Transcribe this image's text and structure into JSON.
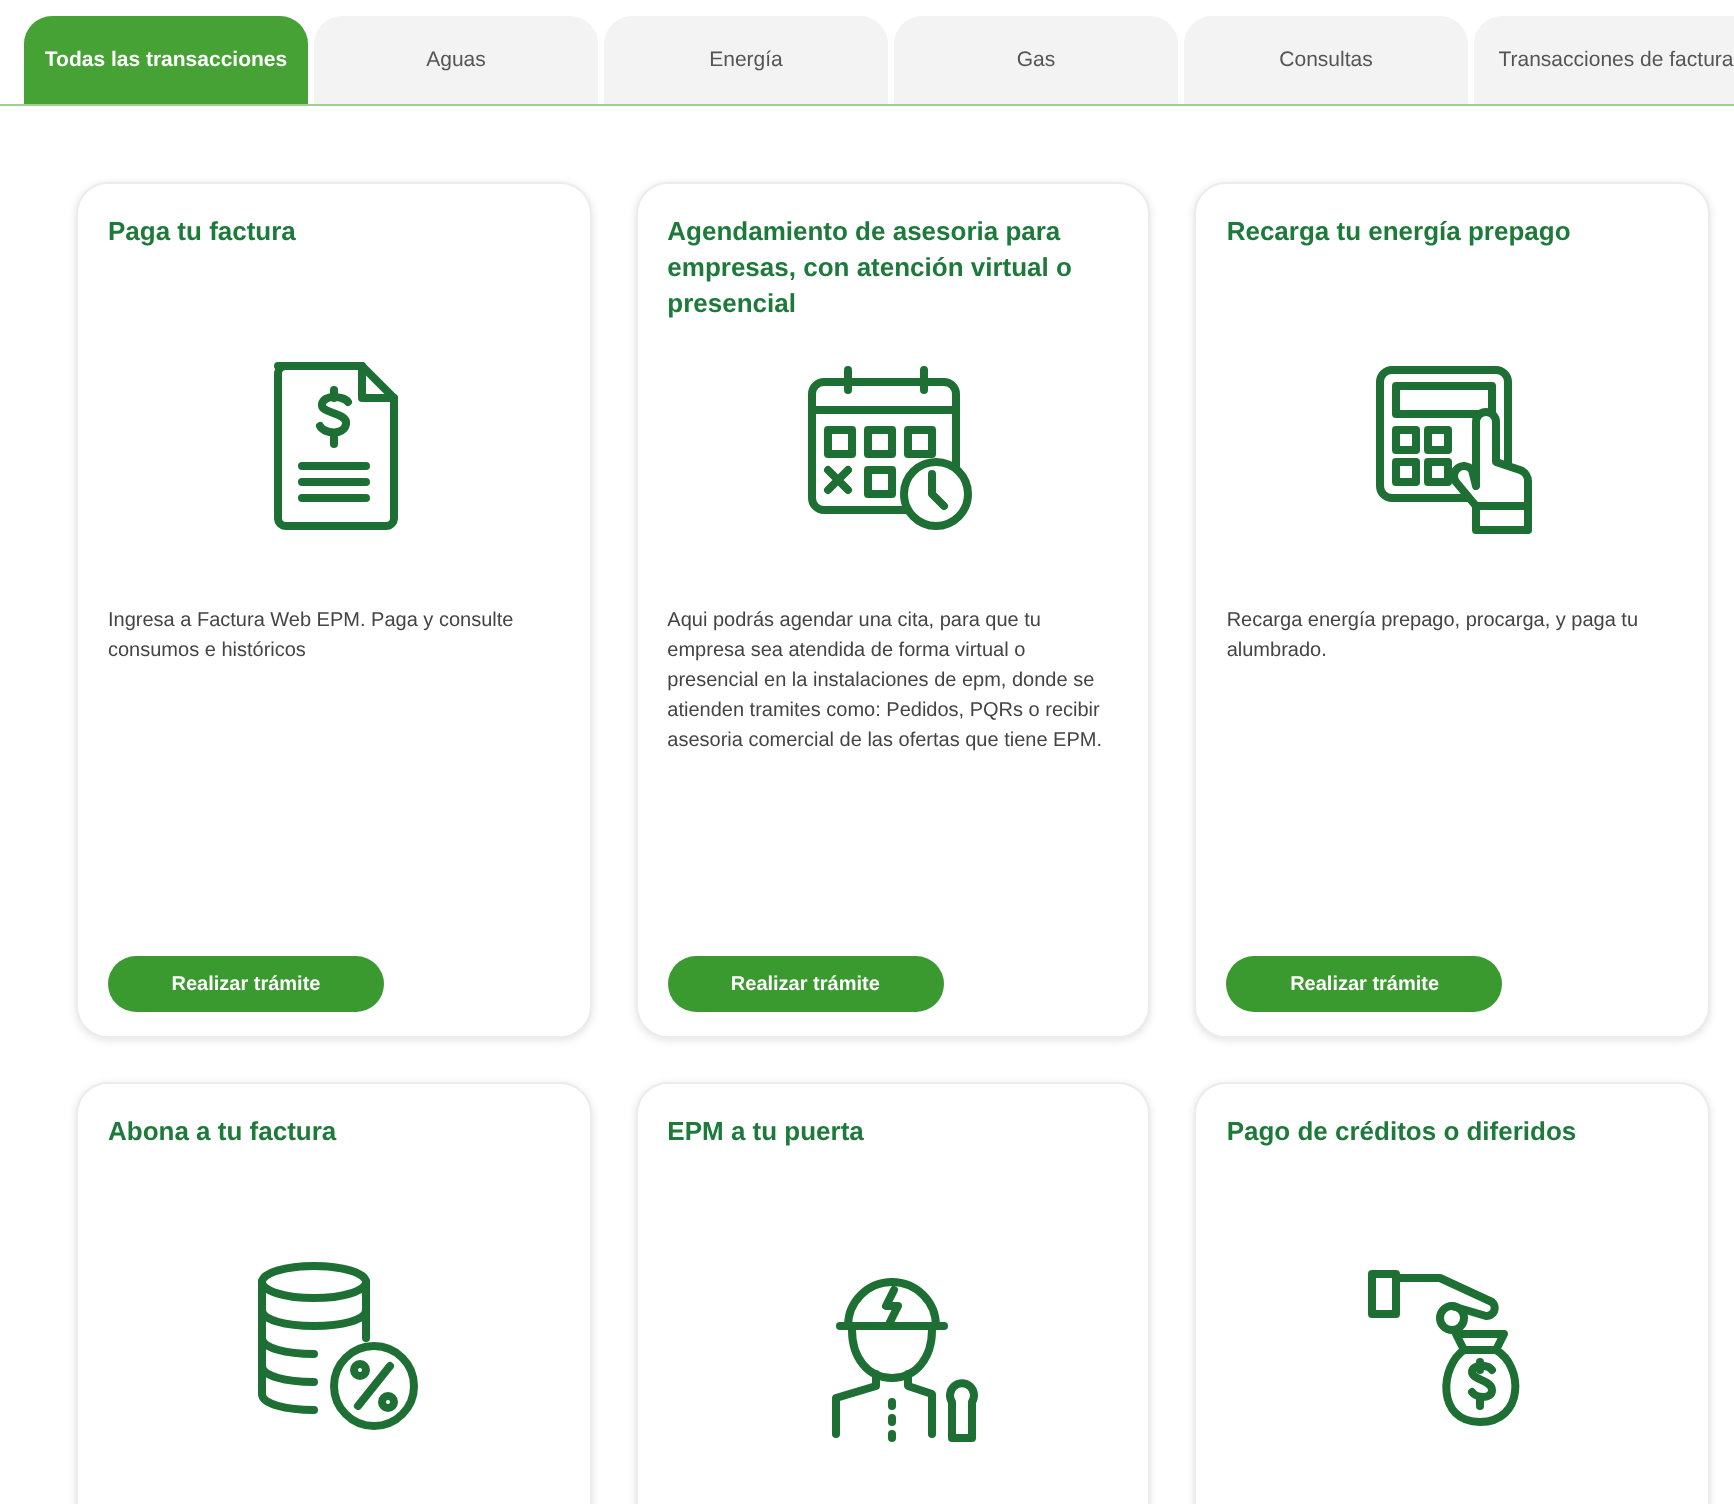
{
  "tabs": [
    {
      "label": "Todas las transacciones",
      "selected": true
    },
    {
      "label": "Aguas",
      "selected": false
    },
    {
      "label": "Energía",
      "selected": false
    },
    {
      "label": "Gas",
      "selected": false
    },
    {
      "label": "Consultas",
      "selected": false
    },
    {
      "label": "Transacciones de factura",
      "selected": false
    }
  ],
  "cards": [
    {
      "title": "Paga tu factura",
      "description": "Ingresa a Factura Web EPM. Paga y consulte consumos e históricos",
      "button": "Realizar trámite"
    },
    {
      "title": "Agendamiento de asesoria para empresas, con atención virtual o presencial",
      "description": "Aqui podrás agendar una cita, para que tu empresa sea atendida de forma virtual o presencial en la instalaciones de epm, donde se atienden tramites como: Pedidos, PQRs o recibir asesoria comercial de las ofertas que tiene EPM.",
      "button": "Realizar trámite"
    },
    {
      "title": "Recarga tu energía prepago",
      "description": "Recarga energía prepago, procarga, y paga tu alumbrado.",
      "button": "Realizar trámite"
    },
    {
      "title": "Abona a tu factura"
    },
    {
      "title": "EPM a tu puerta"
    },
    {
      "title": "Pago de créditos o diferidos"
    }
  ]
}
